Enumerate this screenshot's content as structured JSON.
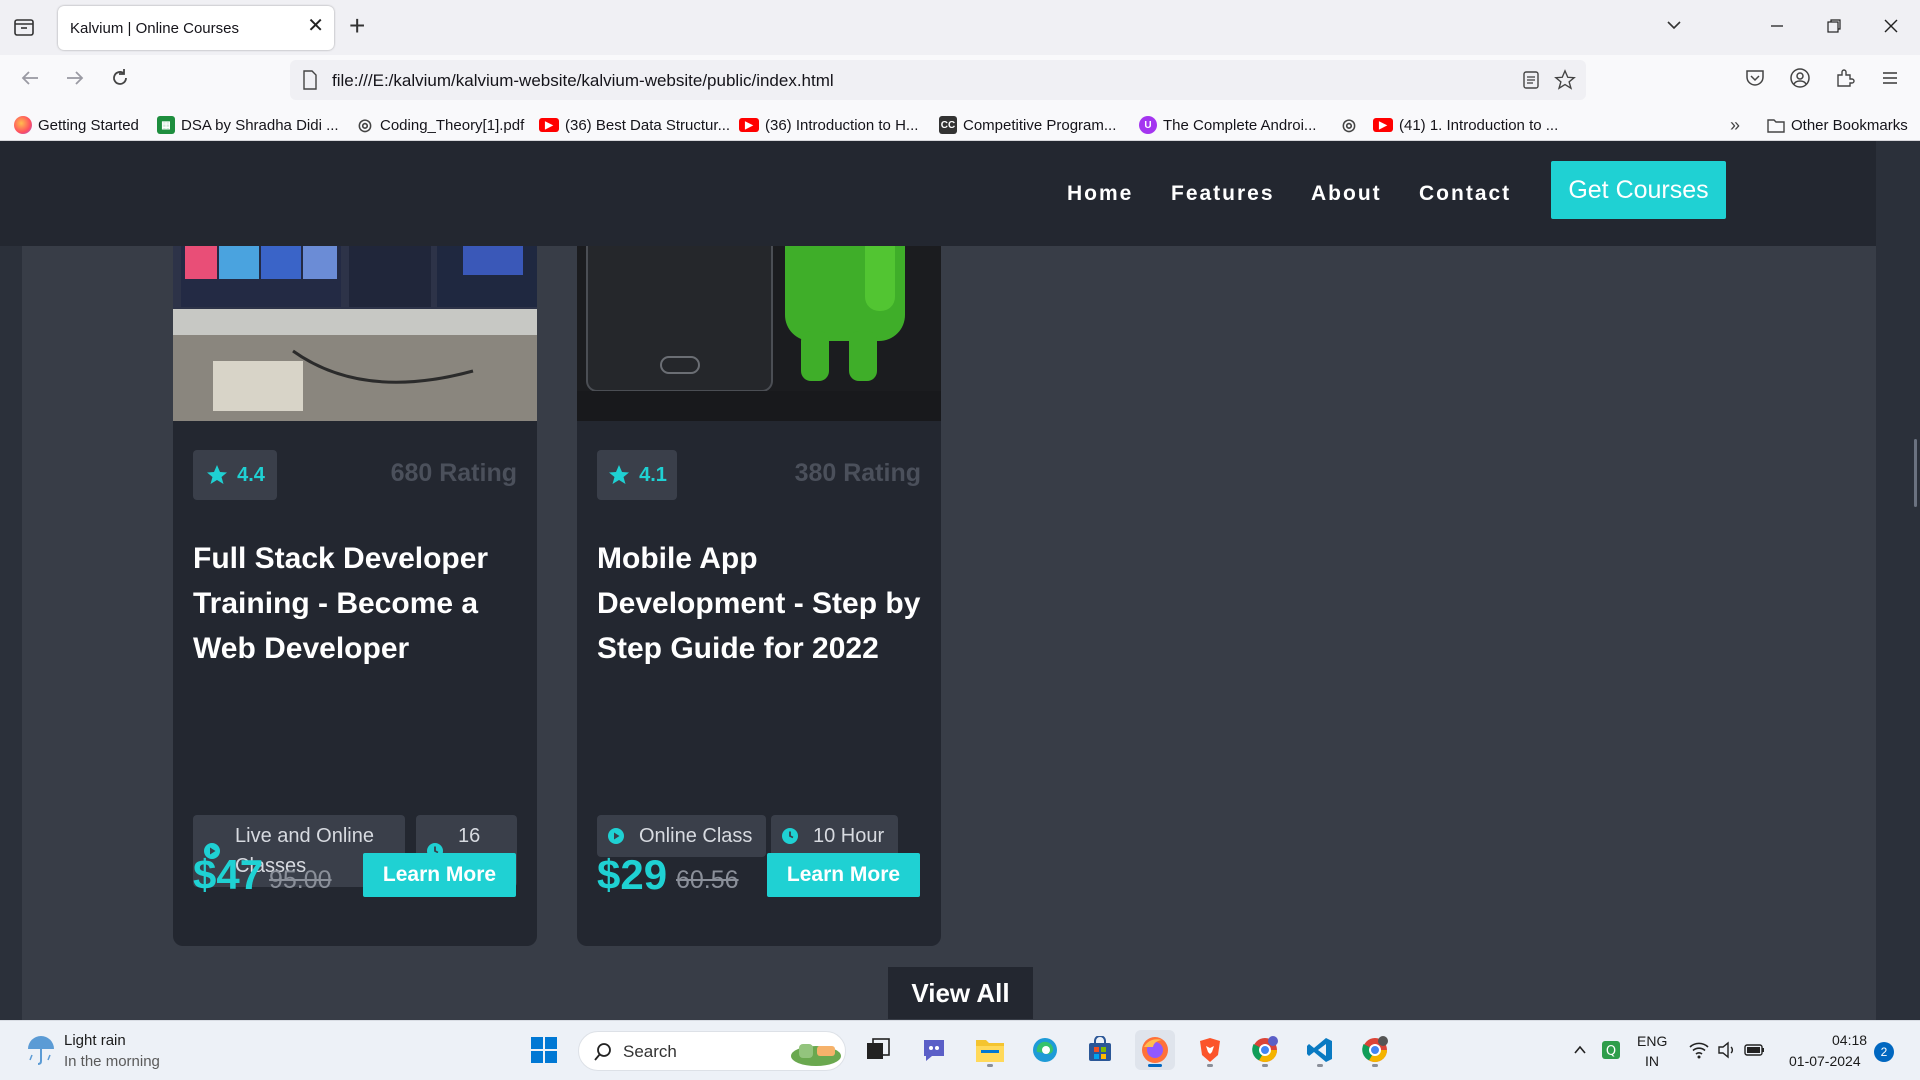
{
  "browser": {
    "tab_title": "Kalvium | Online Courses",
    "url": "file:///E:/kalvium/kalvium-website/kalvium-website/public/index.html",
    "bookmarks": [
      {
        "label": "Getting Started",
        "icon": "firefox-icon"
      },
      {
        "label": "DSA by Shradha Didi ...",
        "icon": "sheets-icon"
      },
      {
        "label": "Coding_Theory[1].pdf",
        "icon": "globe-icon"
      },
      {
        "label": "(36) Best Data Structur...",
        "icon": "youtube-icon"
      },
      {
        "label": "(36) Introduction to H...",
        "icon": "youtube-icon"
      },
      {
        "label": "Competitive Program...",
        "icon": "cc-icon"
      },
      {
        "label": "The Complete Androi...",
        "icon": "udemy-icon"
      },
      {
        "label": "",
        "icon": "globe-icon"
      },
      {
        "label": "(41) 1. Introduction to ...",
        "icon": "youtube-icon"
      }
    ],
    "other_bookmarks": "Other Bookmarks"
  },
  "site": {
    "menu": [
      "Home",
      "Features",
      "About",
      "Contact"
    ],
    "cta": "Get Courses",
    "accent_color": "#1fd1d3",
    "courses": [
      {
        "rating": "4.4",
        "rating_count": "680 Rating",
        "title": "Full Stack Developer Training - Become a Web Developer",
        "mode": "Live and Online Classes",
        "duration": "16 Hour",
        "price": "$47",
        "old_price": "95.00",
        "button": "Learn More"
      },
      {
        "rating": "4.1",
        "rating_count": "380 Rating",
        "title": "Mobile App Development - Step by Step Guide for 2022",
        "mode": "Online Class",
        "duration": "10 Hour",
        "price": "$29",
        "old_price": "60.56",
        "button": "Learn More"
      }
    ],
    "view_all": "View All"
  },
  "taskbar": {
    "weather_main": "Light rain",
    "weather_sub": "In the morning",
    "search_placeholder": "Search",
    "lang_top": "ENG",
    "lang_bottom": "IN",
    "time": "04:18",
    "date": "01-07-2024",
    "notifications": "2"
  }
}
